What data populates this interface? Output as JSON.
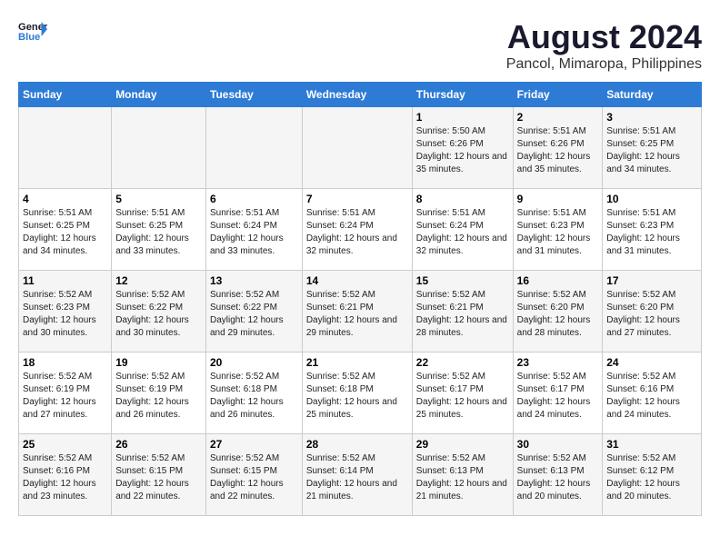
{
  "logo": {
    "line1": "General",
    "line2": "Blue"
  },
  "title": "August 2024",
  "subtitle": "Pancol, Mimaropa, Philippines",
  "weekdays": [
    "Sunday",
    "Monday",
    "Tuesday",
    "Wednesday",
    "Thursday",
    "Friday",
    "Saturday"
  ],
  "weeks": [
    [
      {
        "day": "",
        "info": ""
      },
      {
        "day": "",
        "info": ""
      },
      {
        "day": "",
        "info": ""
      },
      {
        "day": "",
        "info": ""
      },
      {
        "day": "1",
        "info": "Sunrise: 5:50 AM\nSunset: 6:26 PM\nDaylight: 12 hours\nand 35 minutes."
      },
      {
        "day": "2",
        "info": "Sunrise: 5:51 AM\nSunset: 6:26 PM\nDaylight: 12 hours\nand 35 minutes."
      },
      {
        "day": "3",
        "info": "Sunrise: 5:51 AM\nSunset: 6:25 PM\nDaylight: 12 hours\nand 34 minutes."
      }
    ],
    [
      {
        "day": "4",
        "info": "Sunrise: 5:51 AM\nSunset: 6:25 PM\nDaylight: 12 hours\nand 34 minutes."
      },
      {
        "day": "5",
        "info": "Sunrise: 5:51 AM\nSunset: 6:25 PM\nDaylight: 12 hours\nand 33 minutes."
      },
      {
        "day": "6",
        "info": "Sunrise: 5:51 AM\nSunset: 6:24 PM\nDaylight: 12 hours\nand 33 minutes."
      },
      {
        "day": "7",
        "info": "Sunrise: 5:51 AM\nSunset: 6:24 PM\nDaylight: 12 hours\nand 32 minutes."
      },
      {
        "day": "8",
        "info": "Sunrise: 5:51 AM\nSunset: 6:24 PM\nDaylight: 12 hours\nand 32 minutes."
      },
      {
        "day": "9",
        "info": "Sunrise: 5:51 AM\nSunset: 6:23 PM\nDaylight: 12 hours\nand 31 minutes."
      },
      {
        "day": "10",
        "info": "Sunrise: 5:51 AM\nSunset: 6:23 PM\nDaylight: 12 hours\nand 31 minutes."
      }
    ],
    [
      {
        "day": "11",
        "info": "Sunrise: 5:52 AM\nSunset: 6:23 PM\nDaylight: 12 hours\nand 30 minutes."
      },
      {
        "day": "12",
        "info": "Sunrise: 5:52 AM\nSunset: 6:22 PM\nDaylight: 12 hours\nand 30 minutes."
      },
      {
        "day": "13",
        "info": "Sunrise: 5:52 AM\nSunset: 6:22 PM\nDaylight: 12 hours\nand 29 minutes."
      },
      {
        "day": "14",
        "info": "Sunrise: 5:52 AM\nSunset: 6:21 PM\nDaylight: 12 hours\nand 29 minutes."
      },
      {
        "day": "15",
        "info": "Sunrise: 5:52 AM\nSunset: 6:21 PM\nDaylight: 12 hours\nand 28 minutes."
      },
      {
        "day": "16",
        "info": "Sunrise: 5:52 AM\nSunset: 6:20 PM\nDaylight: 12 hours\nand 28 minutes."
      },
      {
        "day": "17",
        "info": "Sunrise: 5:52 AM\nSunset: 6:20 PM\nDaylight: 12 hours\nand 27 minutes."
      }
    ],
    [
      {
        "day": "18",
        "info": "Sunrise: 5:52 AM\nSunset: 6:19 PM\nDaylight: 12 hours\nand 27 minutes."
      },
      {
        "day": "19",
        "info": "Sunrise: 5:52 AM\nSunset: 6:19 PM\nDaylight: 12 hours\nand 26 minutes."
      },
      {
        "day": "20",
        "info": "Sunrise: 5:52 AM\nSunset: 6:18 PM\nDaylight: 12 hours\nand 26 minutes."
      },
      {
        "day": "21",
        "info": "Sunrise: 5:52 AM\nSunset: 6:18 PM\nDaylight: 12 hours\nand 25 minutes."
      },
      {
        "day": "22",
        "info": "Sunrise: 5:52 AM\nSunset: 6:17 PM\nDaylight: 12 hours\nand 25 minutes."
      },
      {
        "day": "23",
        "info": "Sunrise: 5:52 AM\nSunset: 6:17 PM\nDaylight: 12 hours\nand 24 minutes."
      },
      {
        "day": "24",
        "info": "Sunrise: 5:52 AM\nSunset: 6:16 PM\nDaylight: 12 hours\nand 24 minutes."
      }
    ],
    [
      {
        "day": "25",
        "info": "Sunrise: 5:52 AM\nSunset: 6:16 PM\nDaylight: 12 hours\nand 23 minutes."
      },
      {
        "day": "26",
        "info": "Sunrise: 5:52 AM\nSunset: 6:15 PM\nDaylight: 12 hours\nand 22 minutes."
      },
      {
        "day": "27",
        "info": "Sunrise: 5:52 AM\nSunset: 6:15 PM\nDaylight: 12 hours\nand 22 minutes."
      },
      {
        "day": "28",
        "info": "Sunrise: 5:52 AM\nSunset: 6:14 PM\nDaylight: 12 hours\nand 21 minutes."
      },
      {
        "day": "29",
        "info": "Sunrise: 5:52 AM\nSunset: 6:13 PM\nDaylight: 12 hours\nand 21 minutes."
      },
      {
        "day": "30",
        "info": "Sunrise: 5:52 AM\nSunset: 6:13 PM\nDaylight: 12 hours\nand 20 minutes."
      },
      {
        "day": "31",
        "info": "Sunrise: 5:52 AM\nSunset: 6:12 PM\nDaylight: 12 hours\nand 20 minutes."
      }
    ]
  ]
}
